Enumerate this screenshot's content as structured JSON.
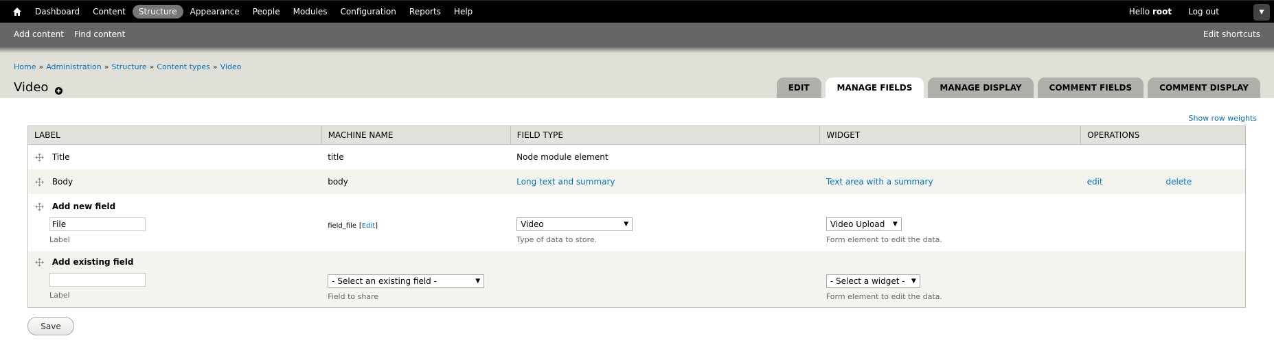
{
  "toolbar": {
    "nav": [
      "Dashboard",
      "Content",
      "Structure",
      "Appearance",
      "People",
      "Modules",
      "Configuration",
      "Reports",
      "Help"
    ],
    "active": "Structure",
    "hello": "Hello",
    "user": "root",
    "logout": "Log out"
  },
  "shortcuts": {
    "items": [
      "Add content",
      "Find content"
    ],
    "edit": "Edit shortcuts"
  },
  "breadcrumb": [
    "Home",
    "Administration",
    "Structure",
    "Content types",
    "Video"
  ],
  "breadcrumb_sep": "»",
  "page_title": "Video",
  "tabs": [
    "EDIT",
    "MANAGE FIELDS",
    "MANAGE DISPLAY",
    "COMMENT FIELDS",
    "COMMENT DISPLAY"
  ],
  "active_tab": "MANAGE FIELDS",
  "show_row_weights": "Show row weights",
  "table": {
    "headers": [
      "LABEL",
      "MACHINE NAME",
      "FIELD TYPE",
      "WIDGET",
      "OPERATIONS"
    ],
    "rows": [
      {
        "label": "Title",
        "machine": "title",
        "type": "Node module element"
      },
      {
        "label": "Body",
        "machine": "body",
        "type": "Long text and summary",
        "widget": "Text area with a summary",
        "edit": "edit",
        "delete": "delete"
      }
    ],
    "add_new": {
      "title": "Add new field",
      "label_value": "File",
      "label_desc": "Label",
      "machine": "field_file",
      "machine_edit": "Edit",
      "type_select": "Video",
      "type_desc": "Type of data to store.",
      "widget_select": "Video Upload",
      "widget_desc": "Form element to edit the data."
    },
    "add_existing": {
      "title": "Add existing field",
      "label_value": "",
      "label_desc": "Label",
      "field_select": "- Select an existing field -",
      "field_desc": "Field to share",
      "widget_select": "- Select a widget -",
      "widget_desc": "Form element to edit the data."
    }
  },
  "save": "Save"
}
